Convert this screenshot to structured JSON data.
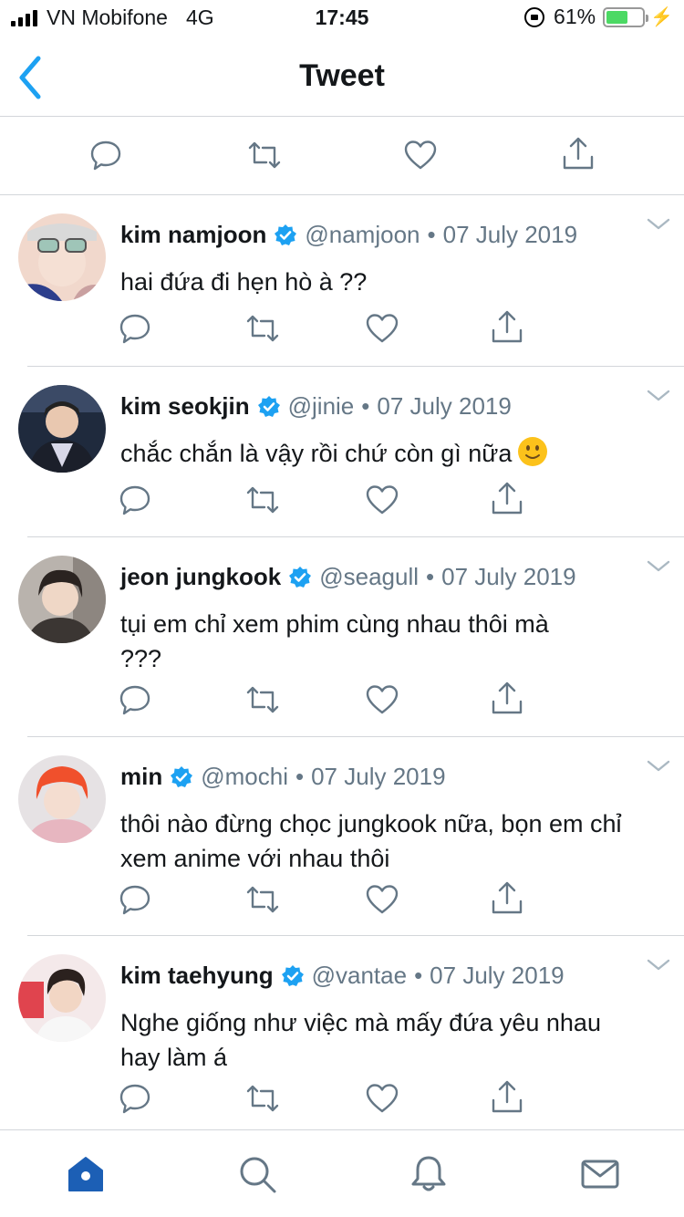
{
  "status_bar": {
    "carrier": "VN Mobifone",
    "network": "4G",
    "time": "17:45",
    "battery": "61%",
    "battery_level": 0.61
  },
  "header": {
    "title": "Tweet",
    "back_icon": "chevron-left-icon"
  },
  "colors": {
    "accent": "#1da1f2",
    "text": "#14171a",
    "secondary": "#657786",
    "border": "#d3d6da",
    "battery_green": "#4cd964",
    "tab_active": "#1c5fb5"
  },
  "replies": [
    {
      "name": "kim namjoon",
      "handle": "@namjoon",
      "separator": "•",
      "date": "07 July 2019",
      "text": "hai đứa đi hẹn hò à ??"
    },
    {
      "name": "kim seokjin",
      "handle": "@jinie",
      "separator": "•",
      "date": "07 July 2019",
      "text": "chắc chắn là vậy rồi chứ còn gì nữa"
    },
    {
      "name": "jeon jungkook",
      "handle": "@seagull",
      "separator": "•",
      "date": "07 July 2019",
      "text": "tụi em chỉ xem phim cùng nhau thôi mà ???"
    },
    {
      "name": "min",
      "handle": "@mochi",
      "separator": "•",
      "date": "07 July 2019",
      "text": "thôi nào đừng chọc jungkook nữa, bọn em chỉ xem anime với nhau thôi"
    },
    {
      "name": "kim taehyung",
      "handle": "@vantae",
      "separator": "•",
      "date": "07 July 2019",
      "text": "Nghe giống như việc mà mấy đứa yêu nhau hay làm á"
    }
  ],
  "tabbar": {
    "items": [
      "home-icon",
      "search-icon",
      "notifications-bell-icon",
      "messages-envelope-icon"
    ],
    "active": "home-icon"
  }
}
